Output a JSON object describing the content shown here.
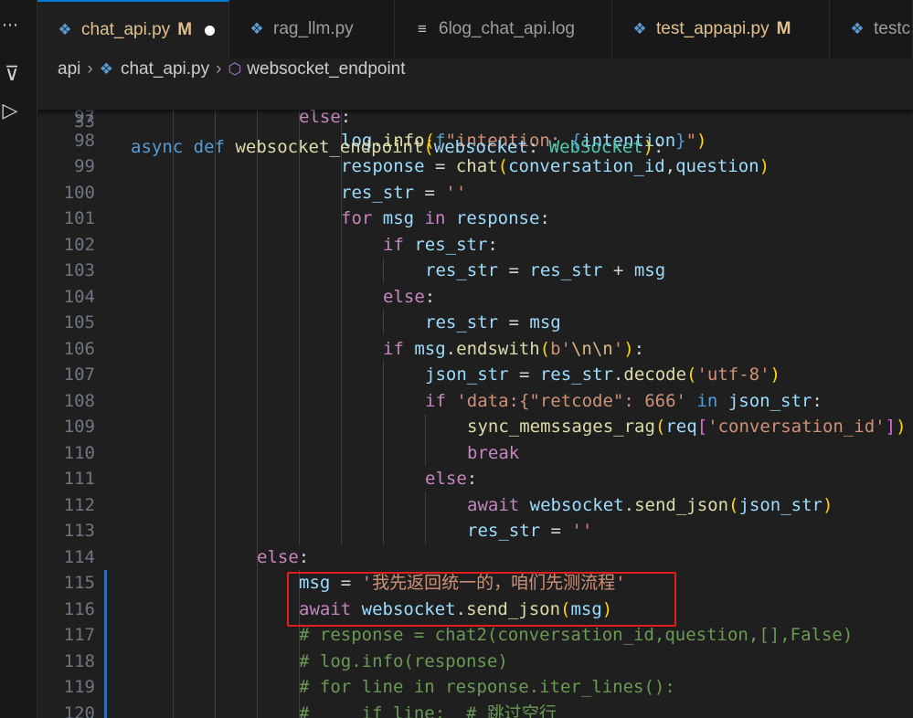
{
  "tabs": [
    {
      "label": "chat_api.py",
      "badge": "M",
      "icon": "python-icon",
      "active": true,
      "dirty": true
    },
    {
      "label": "rag_llm.py",
      "badge": "",
      "icon": "python-icon"
    },
    {
      "label": "6log_chat_api.log",
      "badge": "",
      "icon": "log-icon"
    },
    {
      "label": "test_appapi.py",
      "badge": "M",
      "icon": "python-icon"
    },
    {
      "label": "testc",
      "badge": "",
      "icon": "python-icon"
    }
  ],
  "breadcrumb": {
    "folder": "api",
    "file": "chat_api.py",
    "symbol": "websocket_endpoint"
  },
  "sticky": {
    "line_number": "33",
    "text": "async def websocket_endpoint(websocket: WebSocket):"
  },
  "lines": [
    {
      "n": "97",
      "text": "else:"
    },
    {
      "n": "98",
      "text": "log.info(f\"intention: {intention}\")"
    },
    {
      "n": "99",
      "text": "response = chat(conversation_id,question)"
    },
    {
      "n": "100",
      "text": "res_str = ''"
    },
    {
      "n": "101",
      "text": "for msg in response:"
    },
    {
      "n": "102",
      "text": "if res_str:"
    },
    {
      "n": "103",
      "text": "res_str = res_str + msg"
    },
    {
      "n": "104",
      "text": "else:"
    },
    {
      "n": "105",
      "text": "res_str = msg"
    },
    {
      "n": "106",
      "text": "if msg.endswith(b'\\n\\n'):"
    },
    {
      "n": "107",
      "text": "json_str = res_str.decode('utf-8')"
    },
    {
      "n": "108",
      "text": "if 'data:{\"retcode\": 666' in json_str:"
    },
    {
      "n": "109",
      "text": "sync_memssages_rag(req['conversation_id'])"
    },
    {
      "n": "110",
      "text": "break"
    },
    {
      "n": "111",
      "text": "else:"
    },
    {
      "n": "112",
      "text": "await websocket.send_json(json_str)"
    },
    {
      "n": "113",
      "text": "res_str = ''"
    },
    {
      "n": "114",
      "text": "else:"
    },
    {
      "n": "115",
      "text": "msg = '我先返回统一的，咱们先测流程'"
    },
    {
      "n": "116",
      "text": "await websocket.send_json(msg)"
    },
    {
      "n": "117",
      "text": "# response = chat2(conversation_id,question,[],False)"
    },
    {
      "n": "118",
      "text": "# log.info(response)"
    },
    {
      "n": "119",
      "text": "# for line in response.iter_lines():"
    },
    {
      "n": "120",
      "text": "#     if line:  # 跳过空行"
    }
  ],
  "colors": {
    "keyword": "#c586c0",
    "keyword_def": "#569cd6",
    "function": "#dcdcaa",
    "variable": "#9cdcfe",
    "string": "#ce9178",
    "comment": "#6a9955",
    "number": "#b5cea8",
    "type": "#4ec9b0",
    "highlight_box": "#e21f1f",
    "modified_badge": "#e2c08d"
  }
}
